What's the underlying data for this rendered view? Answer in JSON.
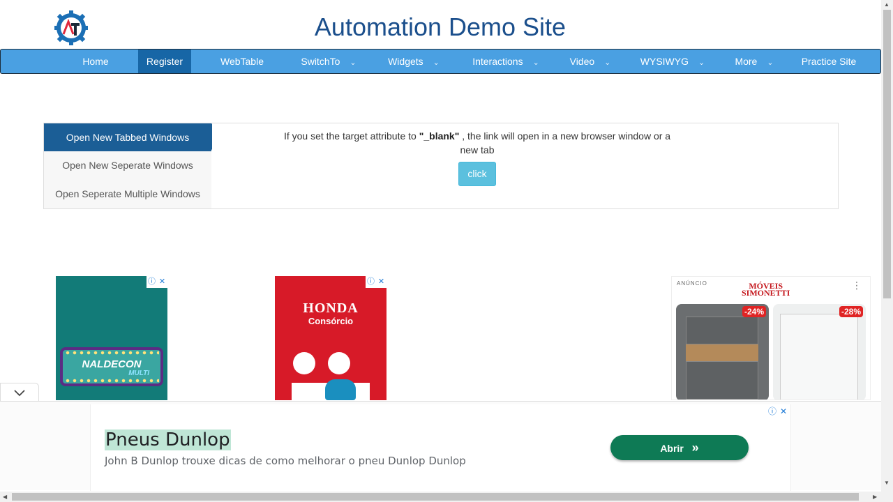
{
  "header": {
    "title": "Automation Demo Site",
    "logo_icon": "gear-logo-icon",
    "logo_letters": "AT"
  },
  "nav": {
    "items": [
      {
        "label": "Home",
        "has_dropdown": false
      },
      {
        "label": "Register",
        "has_dropdown": false,
        "active": true
      },
      {
        "label": "WebTable",
        "has_dropdown": false
      },
      {
        "label": "SwitchTo",
        "has_dropdown": true
      },
      {
        "label": "Widgets",
        "has_dropdown": true
      },
      {
        "label": "Interactions",
        "has_dropdown": true
      },
      {
        "label": "Video",
        "has_dropdown": true
      },
      {
        "label": "WYSIWYG",
        "has_dropdown": true
      },
      {
        "label": "More",
        "has_dropdown": true
      },
      {
        "label": "Practice Site",
        "has_dropdown": false
      }
    ],
    "caret": "⌄"
  },
  "tabs": {
    "items": [
      {
        "label": "Open New Tabbed Windows",
        "active": true
      },
      {
        "label": "Open New Seperate Windows",
        "active": false
      },
      {
        "label": "Open Seperate Multiple Windows",
        "active": false
      }
    ],
    "content": {
      "text_before": "If you set the target attribute to",
      "target_value": "\"_blank\"",
      "text_after": ", the link will open in a new browser window or a new tab",
      "button_label": "click"
    }
  },
  "ads": {
    "ad1": {
      "brand": "NALDECON",
      "sub": "MULTI"
    },
    "ad2": {
      "brand": "HONDA",
      "sub": "Consórcio"
    },
    "ad3": {
      "label": "ANÚNCIO",
      "brand_line1": "MÓVEIS",
      "brand_line2": "SIMONETTI",
      "products": [
        {
          "discount": "-24%"
        },
        {
          "discount": "-28%"
        }
      ]
    },
    "anchor": {
      "title": "Pneus Dunlop",
      "description": "John B Dunlop trouxe dicas de como melhorar o pneu Dunlop Dunlop",
      "button_label": "Abrir",
      "button_icon": "»"
    }
  },
  "colors": {
    "nav_bg": "#4aa0e2",
    "nav_active": "#1766a6",
    "tab_active": "#1b5e96",
    "button": "#5bc0de",
    "title": "#1b4f8c"
  }
}
